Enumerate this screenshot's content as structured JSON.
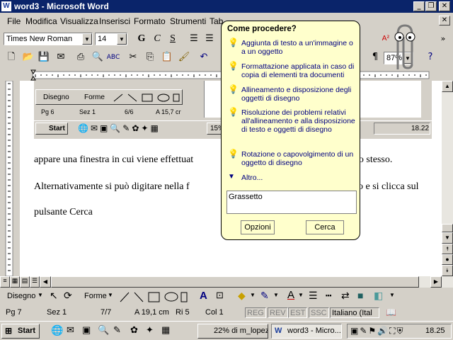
{
  "window": {
    "title": "word3 - Microsoft Word",
    "app_icon": "W"
  },
  "menu": [
    "File",
    "Modifica",
    "Visualizza",
    "Inserisci",
    "Formato",
    "Strumenti",
    "Tab"
  ],
  "formatting": {
    "font": "Times New Roman",
    "size": "14",
    "bold": "G",
    "italic": "C",
    "underline": "S"
  },
  "standard": {
    "zoom": "87%"
  },
  "document": {
    "line1": "appare una finestra in cui viene effettuat",
    "line1_tail": "nto stesso.",
    "line2": "Alternativamente si può digitare nella f",
    "line2_tail": "o e si clicca sul",
    "line3": "pulsante Cerca"
  },
  "embedded": {
    "draw_label": "Disegno",
    "forme_label": "Forme",
    "status_pg": "Pg 6",
    "status_sez": "Sez 1",
    "status_pages": "6/6",
    "status_at": "A 15,7 cr",
    "start_label": "Start",
    "task_partial": "15%",
    "clock": "18.22"
  },
  "assistant": {
    "title": "Come procedere?",
    "items": [
      "Aggiunta di testo a un'immagine o a un oggetto",
      "Formattazione applicata in caso di copia di elementi tra documenti",
      "Allineamento e disposizione degli oggetti di disegno",
      "Risoluzione dei problemi relativi all'allineamento e alla disposizione di testo e oggetti di disegno",
      "Rotazione o capovolgimento di un oggetto di disegno"
    ],
    "more": "Altro...",
    "query": "Grassetto",
    "options_button": "Opzioni",
    "search_button": "Cerca"
  },
  "drawbar": {
    "draw_label": "Disegno",
    "forme_label": "Forme"
  },
  "status": {
    "page": "Pg 7",
    "section": "Sez 1",
    "pages": "7/7",
    "at": "A 19,1 cm",
    "line": "Ri 5",
    "col": "Col 1",
    "reg": "REG",
    "rev": "REV",
    "est": "EST",
    "ssc": "SSC",
    "language": "Italiano (Ital"
  },
  "taskbar": {
    "start": "Start",
    "tasks": [
      "22% di m_lopez_...",
      "word3 - Micro..."
    ],
    "clock": "18.25"
  },
  "colors": {
    "title_bar": "#0a246a",
    "balloon": "#ffffcc",
    "link": "#000080",
    "face": "#d4d0c8"
  }
}
